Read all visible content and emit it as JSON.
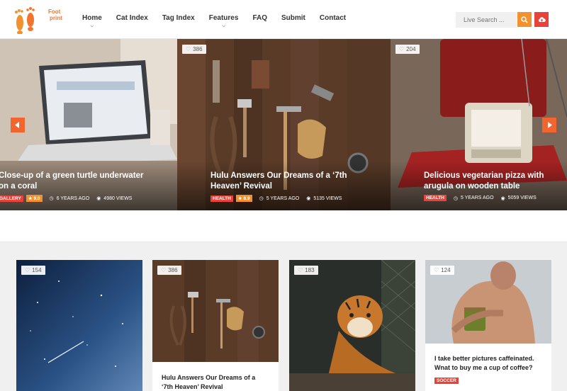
{
  "header": {
    "logo_line1": "Foot",
    "logo_line2": "print",
    "nav": [
      "Home",
      "Cat Index",
      "Tag Index",
      "Features",
      "FAQ",
      "Submit",
      "Contact"
    ],
    "search_placeholder": "Live Search ...",
    "icons": {
      "search": "search-icon",
      "upload": "cloud-upload-icon"
    }
  },
  "slider": {
    "slides": [
      {
        "title_line1": "Close-up of a green turtle underwater",
        "title_line2": "on a coral",
        "category": "GALLERY",
        "rating": "9.0",
        "time": "6 YEARS AGO",
        "views": "4980 VIEWS"
      },
      {
        "likes": "386",
        "title_line1": "Hulu Answers Our Dreams of a ‘7th",
        "title_line2": "Heaven’ Revival",
        "category": "HEALTH",
        "rating": "8.9",
        "time": "5 YEARS AGO",
        "views": "5135 VIEWS"
      },
      {
        "likes": "204",
        "title_line1": "Delicious vegetarian pizza with",
        "title_line2": "arugula on wooden table",
        "category": "HEALTH",
        "time": "5 YEARS AGO",
        "views": "5059 VIEWS"
      }
    ]
  },
  "cards": [
    {
      "likes": "154"
    },
    {
      "likes": "386",
      "title_line1": "Hulu Answers Our Dreams of a",
      "title_line2": "‘7th Heaven’ Revival"
    },
    {
      "likes": "183"
    },
    {
      "likes": "124",
      "title_line1": "I take better pictures caffeinated.",
      "title_line2": "Wnat to buy me a cup of coffee?",
      "category": "SOCCER"
    }
  ],
  "colors": {
    "accent_orange": "#f2912e",
    "accent_red": "#e8433a",
    "arrow_orange": "#f2652e"
  }
}
